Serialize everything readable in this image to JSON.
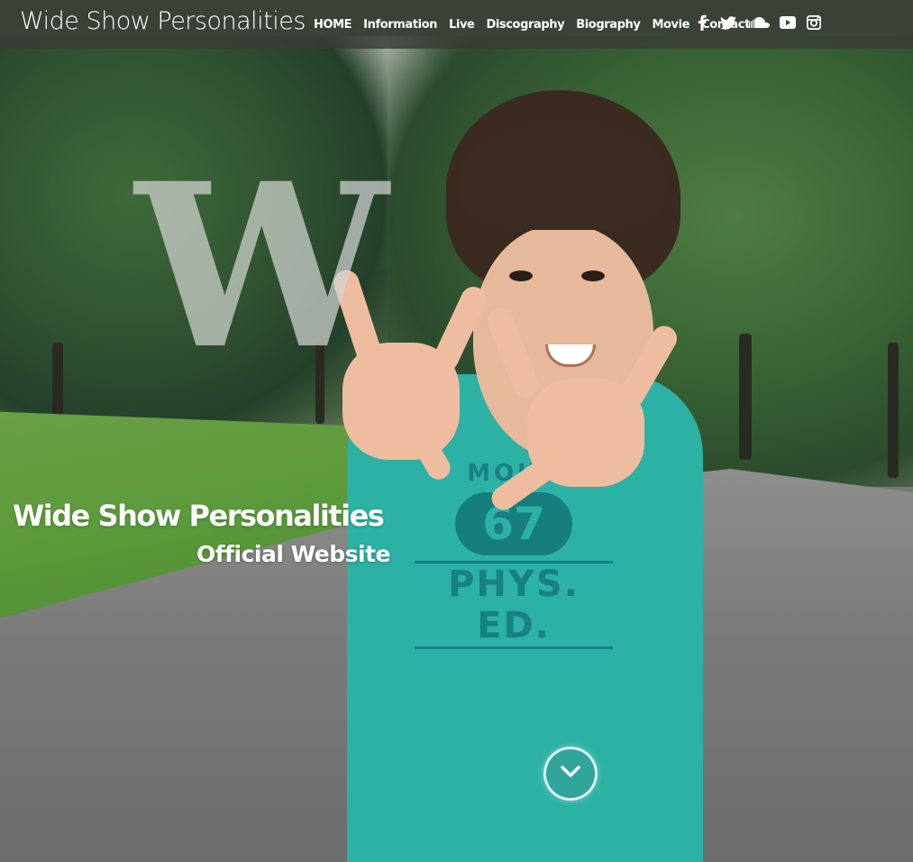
{
  "site": {
    "logo_text": "Wide Show Personalities"
  },
  "nav": {
    "items": [
      {
        "label": "HOME"
      },
      {
        "label": "Information"
      },
      {
        "label": "Live"
      },
      {
        "label": "Discography"
      },
      {
        "label": "Biography"
      },
      {
        "label": "Movie"
      },
      {
        "label": "Contact"
      }
    ]
  },
  "social": {
    "icons": [
      "facebook-icon",
      "twitter-icon",
      "soundcloud-icon",
      "youtube-icon",
      "instagram-icon"
    ]
  },
  "hero": {
    "watermark_letter": "W",
    "title": "Wide Show Personalities",
    "subtitle": "Official Website",
    "scroll_icon": "chevron-down-icon"
  },
  "photo_text": {
    "shirt_top": "MOUS",
    "shirt_number": "67",
    "shirt_bottom": "PHYS. ED."
  },
  "colors": {
    "navbar_bg": "#3a3c37",
    "text": "#ffffff",
    "shirt": "#2cb1a5"
  }
}
